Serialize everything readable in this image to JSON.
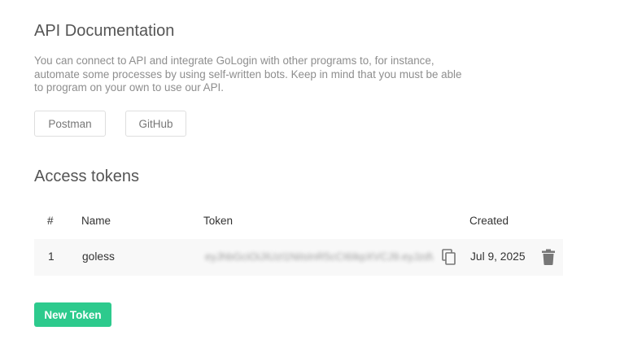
{
  "api_docs": {
    "title": "API Documentation",
    "description": "You can connect to API and integrate GoLogin with other programs to, for instance, automate some processes by using self-written bots. Keep in mind that you must be able to program on your own to use our API.",
    "postman_label": "Postman",
    "github_label": "GitHub"
  },
  "access_tokens": {
    "title": "Access tokens",
    "columns": {
      "index": "#",
      "name": "Name",
      "token": "Token",
      "created": "Created"
    },
    "rows": [
      {
        "index": "1",
        "name": "goless",
        "token_masked": "eyJhbGciOiJIUzI1NiIsInR5cCI6IkpXVCJ9.eyJzdWIi...",
        "created": "Jul 9, 2025"
      }
    ],
    "new_token_label": "New Token"
  },
  "icons": {
    "copy": "copy-icon",
    "delete": "trash-icon"
  },
  "colors": {
    "accent": "#2dca8d",
    "row_background": "#f8f8f8",
    "icon": "#777777"
  }
}
